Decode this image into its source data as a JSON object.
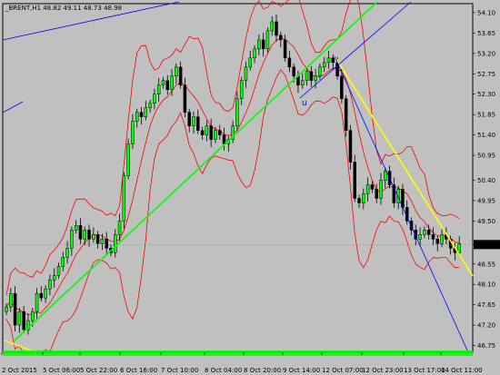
{
  "symbol_header": {
    "symbol": "_BRENT,H1",
    "ohlc": "48.82 49.11 48.73 48.98"
  },
  "current_price": "48.98",
  "colors": {
    "background": "#c0c0c0",
    "bull_candle": "#00ff00",
    "bear_candle": "#000000",
    "bollinger": "#ff0000",
    "trend_green": "#00ff00",
    "trend_yellow": "#ffff00",
    "trend_blue": "#0000ff",
    "price_box": "#000000",
    "indicator_band": "#00ff00"
  },
  "marker_label": "u",
  "chart_data": {
    "type": "candlestick",
    "y_axis_ticks": [
      "54.10",
      "53.65",
      "53.20",
      "52.75",
      "52.30",
      "51.85",
      "51.40",
      "50.95",
      "50.40",
      "49.95",
      "49.50",
      "48.98",
      "48.55",
      "48.10",
      "47.65",
      "47.20",
      "46.75"
    ],
    "x_axis_ticks": [
      "2 Oct 2015",
      "5 Oct 06:00",
      "5 Oct 22:00",
      "6 Oct 16:00",
      "7 Oct 10:00",
      "8 Oct 04:00",
      "8 Oct 20:00",
      "9 Oct 14:00",
      "12 Oct 07:00",
      "12 Oct 23:00",
      "13 Oct 17:00",
      "14 Oct 11:00"
    ],
    "ylim": [
      46.6,
      54.3
    ],
    "close_path": [
      47.6,
      47.9,
      47.2,
      47.5,
      47.1,
      47.3,
      47.5,
      47.9,
      47.8,
      48.0,
      48.2,
      48.3,
      48.5,
      48.7,
      48.9,
      49.3,
      49.4,
      49.1,
      49.3,
      49.1,
      49.2,
      49.0,
      49.1,
      48.9,
      48.8,
      49.2,
      49.5,
      50.5,
      51.2,
      51.7,
      51.9,
      51.8,
      52.0,
      52.1,
      52.3,
      52.5,
      52.6,
      52.4,
      52.7,
      52.9,
      52.5,
      51.9,
      51.6,
      51.8,
      51.5,
      51.4,
      51.6,
      51.3,
      51.5,
      51.4,
      51.2,
      51.3,
      51.6,
      52.2,
      52.6,
      52.9,
      53.1,
      53.3,
      53.5,
      53.3,
      53.7,
      53.9,
      53.6,
      53.5,
      53.1,
      52.9,
      52.7,
      52.5,
      52.6,
      52.8,
      52.6,
      52.7,
      52.9,
      53.0,
      53.1,
      53.0,
      52.7,
      52.2,
      51.5,
      50.8,
      50.0,
      49.9,
      50.1,
      50.3,
      50.2,
      50.0,
      50.4,
      50.6,
      50.3,
      49.9,
      50.2,
      49.8,
      49.5,
      49.3,
      49.1,
      49.2,
      49.3,
      49.2,
      49.1,
      49.0,
      49.2,
      49.1,
      48.9,
      48.8,
      49.0
    ]
  }
}
